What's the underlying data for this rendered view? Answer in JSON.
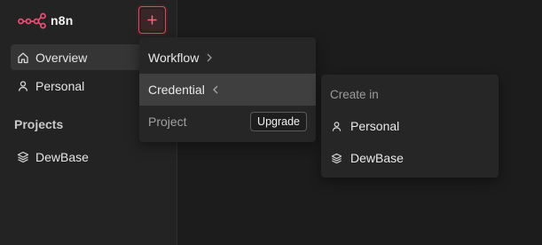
{
  "app": {
    "name": "n8n",
    "brand_color": "#ea4b71"
  },
  "header": {
    "add_button_icon": "plus-icon"
  },
  "sidebar": {
    "items": [
      {
        "label": "Overview",
        "icon": "home-icon",
        "active": true
      },
      {
        "label": "Personal",
        "icon": "user-icon",
        "active": false
      }
    ],
    "projects_title": "Projects",
    "projects": [
      {
        "label": "DewBase",
        "icon": "layers-icon"
      }
    ]
  },
  "create_menu": {
    "items": [
      {
        "label": "Workflow",
        "icon": "chevron-right-icon"
      },
      {
        "label": "Credential",
        "icon": "chevron-left-icon",
        "highlighted": true
      },
      {
        "label": "Project",
        "disabled": true,
        "action_label": "Upgrade"
      }
    ]
  },
  "credential_submenu": {
    "header": "Create in",
    "items": [
      {
        "label": "Personal",
        "icon": "user-icon"
      },
      {
        "label": "DewBase",
        "icon": "layers-icon"
      }
    ]
  }
}
